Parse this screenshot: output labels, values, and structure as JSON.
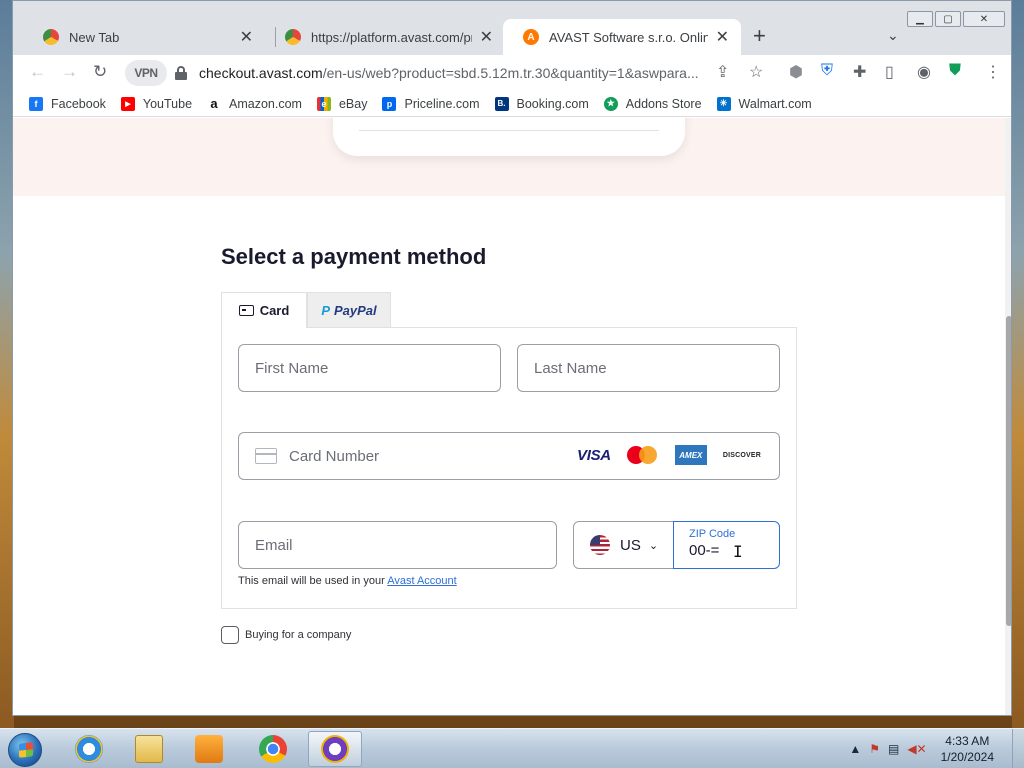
{
  "browser": {
    "tabs": [
      {
        "title": "New Tab",
        "active": false
      },
      {
        "title": "https://platform.avast.com/pro",
        "active": false
      },
      {
        "title": "AVAST Software s.r.o. Online Stor",
        "active": true
      }
    ],
    "new_tab_label": "+",
    "url_host": "checkout.avast.com",
    "url_rest": "/en-us/web?product=sbd.5.12m.tr.30&quantity=1&aswpara...",
    "vpn_label": "VPN",
    "bookmarks": [
      {
        "label": "Facebook",
        "color": "#1877f2",
        "glyph": "f"
      },
      {
        "label": "YouTube",
        "color": "#ff0000",
        "glyph": "▶"
      },
      {
        "label": "Amazon.com",
        "color": "#ffffff",
        "glyph": "a"
      },
      {
        "label": "eBay",
        "color": "#e53238",
        "glyph": "e"
      },
      {
        "label": "Priceline.com",
        "color": "#0068ef",
        "glyph": "p"
      },
      {
        "label": "Booking.com",
        "color": "#003580",
        "glyph": "B."
      },
      {
        "label": "Addons Store",
        "color": "#0f9d58",
        "glyph": "★"
      },
      {
        "label": "Walmart.com",
        "color": "#0071ce",
        "glyph": "✳"
      }
    ]
  },
  "page": {
    "section_title": "Select a payment method",
    "tabs": {
      "card": "Card",
      "paypal": "PayPal"
    },
    "fields": {
      "first_name_placeholder": "First Name",
      "last_name_placeholder": "Last Name",
      "card_number_placeholder": "Card Number",
      "email_placeholder": "Email",
      "country_code": "US",
      "zip_label": "ZIP Code",
      "zip_value": "00-="
    },
    "brands": {
      "visa": "VISA",
      "amex": "AMEX",
      "discover": "DISCOVER"
    },
    "email_hint": "This email will be used in your",
    "email_hint_link": "Avast Account",
    "company_label": "Buying for a company"
  },
  "taskbar": {
    "time": "4:33 AM",
    "date": "1/20/2024"
  }
}
